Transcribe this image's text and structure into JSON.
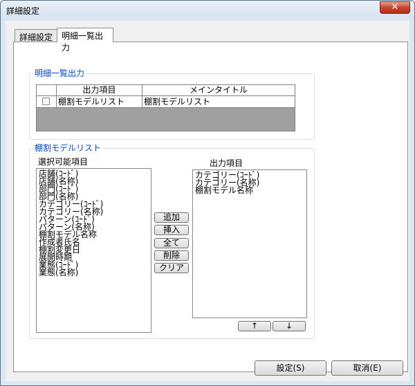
{
  "window": {
    "title": "詳細設定",
    "close": "✕"
  },
  "tabs": [
    {
      "label": "詳細設定"
    },
    {
      "label": "明細一覧出力"
    }
  ],
  "group1": {
    "title": "明細一覧出力",
    "headers": [
      "出力項目",
      "メインタイトル"
    ],
    "row": {
      "item": "棚割モデルリスト",
      "title": "棚割モデルリスト"
    }
  },
  "group2": {
    "title": "棚割モデルリスト",
    "available_label": "選択可能項目",
    "output_label": "出力項目",
    "available": [
      "店舗(ｺｰﾄﾞ)",
      "店舗(名称)",
      "部門(ｺｰﾄﾞ)",
      "部門(名称)",
      "カテゴリー(ｺｰﾄﾞ)",
      "カテゴリー(名称)",
      "パターン(ｺｰﾄﾞ)",
      "パターン(名称)",
      "棚割モデル名称",
      "作成者氏名",
      "棚割変更日",
      "展開時期",
      "業態(ｺｰﾄﾞ)",
      "業態(名称)"
    ],
    "output": [
      "カテゴリー(ｺｰﾄﾞ)",
      "カテゴリー(名称)",
      "棚割モデル名称"
    ],
    "buttons": {
      "add": "追加",
      "insert": "挿入",
      "all": "全て",
      "delete": "削除",
      "clear": "クリア"
    },
    "up": "↑",
    "down": "↓"
  },
  "footer": {
    "ok": "設定(S)",
    "cancel": "取消(E)"
  }
}
